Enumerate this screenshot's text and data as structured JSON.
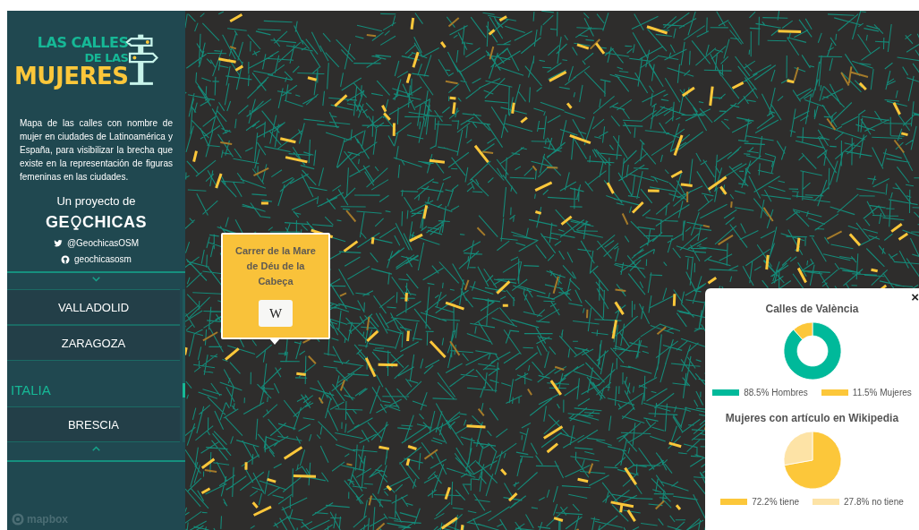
{
  "sidebar": {
    "logo": {
      "line_1": "LAS CALLES",
      "line_2": "DE LAS",
      "line_3": "MUJERES"
    },
    "description": "Mapa de las calles con nombre de mujer en ciudades de Latinoamérica y España, para visibilizar la brecha que existe en la representación de figuras femeninas en las ciudades.",
    "project_label": "Un proyecto de",
    "brand": {
      "before": "GE",
      "after": "CHICAS"
    },
    "social": [
      {
        "kind": "twitter",
        "label": "@GeochicasOSM"
      },
      {
        "kind": "github",
        "label": "geochicasosm"
      }
    ],
    "cities": [
      {
        "kind": "city",
        "label": "VALLADOLID"
      },
      {
        "kind": "city",
        "label": "ZARAGOZA"
      },
      {
        "kind": "country",
        "label": "ITALIA"
      },
      {
        "kind": "city",
        "label": "BRESCIA"
      }
    ],
    "attribution": "mapbox"
  },
  "popup": {
    "title": "Carrer de la Mare de Déu de la Cabeça",
    "button": "W"
  },
  "stats_panel": {
    "close": "×",
    "charts": [
      {
        "chart_data": {
          "type": "donut",
          "title": "Calles de València",
          "series": [
            {
              "values": [
                88.5,
                11.5
              ],
              "colors": [
                "#00b99a",
                "#fcc73a"
              ]
            }
          ]
        },
        "legend": [
          {
            "label": "88.5% Hombres",
            "color": "#00b99a"
          },
          {
            "label": "11.5% Mujeres",
            "color": "#fcc73a"
          }
        ]
      },
      {
        "chart_data": {
          "type": "pie",
          "title": "Mujeres con artículo en Wikipedia",
          "series": [
            {
              "values": [
                72.2,
                27.8
              ],
              "colors": [
                "#fcc73a",
                "#fde3a6"
              ]
            }
          ]
        },
        "legend": [
          {
            "label": "72.2% tiene",
            "color": "#fcc73a"
          },
          {
            "label": "27.8% no tiene",
            "color": "#fde3a6"
          }
        ]
      }
    ]
  }
}
